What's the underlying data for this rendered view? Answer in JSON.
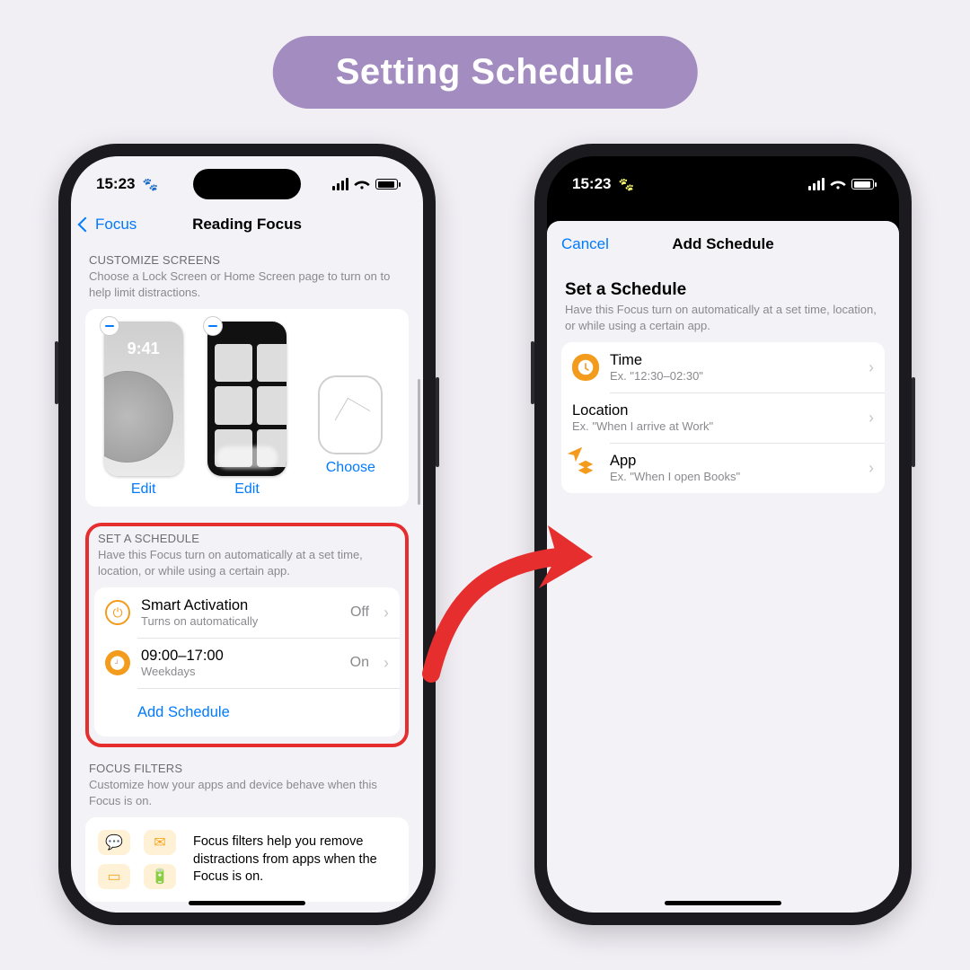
{
  "banner": "Setting Schedule",
  "status_time": "15:23",
  "phone1": {
    "nav_back": "Focus",
    "nav_title": "Reading Focus",
    "customize": {
      "header": "CUSTOMIZE SCREENS",
      "desc": "Choose a Lock Screen or Home Screen page to turn on to help limit distractions.",
      "edit": "Edit",
      "choose": "Choose"
    },
    "schedule": {
      "header": "SET A SCHEDULE",
      "desc": "Have this Focus turn on automatically at a set time, location, or while using a certain app.",
      "smart_title": "Smart Activation",
      "smart_sub": "Turns on automatically",
      "smart_val": "Off",
      "time_title": "09:00–17:00",
      "time_sub": "Weekdays",
      "time_val": "On",
      "add": "Add Schedule"
    },
    "filters": {
      "header": "FOCUS FILTERS",
      "desc": "Customize how your apps and device behave when this Focus is on.",
      "blurb": "Focus filters help you remove distractions from apps when the Focus is on."
    }
  },
  "phone2": {
    "cancel": "Cancel",
    "title": "Add Schedule",
    "set_header": "Set a Schedule",
    "set_desc": "Have this Focus turn on automatically at a set time, location, or while using a certain app.",
    "time_t": "Time",
    "time_s": "Ex. \"12:30–02:30\"",
    "loc_t": "Location",
    "loc_s": "Ex. \"When I arrive at Work\"",
    "app_t": "App",
    "app_s": "Ex. \"When I open Books\""
  }
}
